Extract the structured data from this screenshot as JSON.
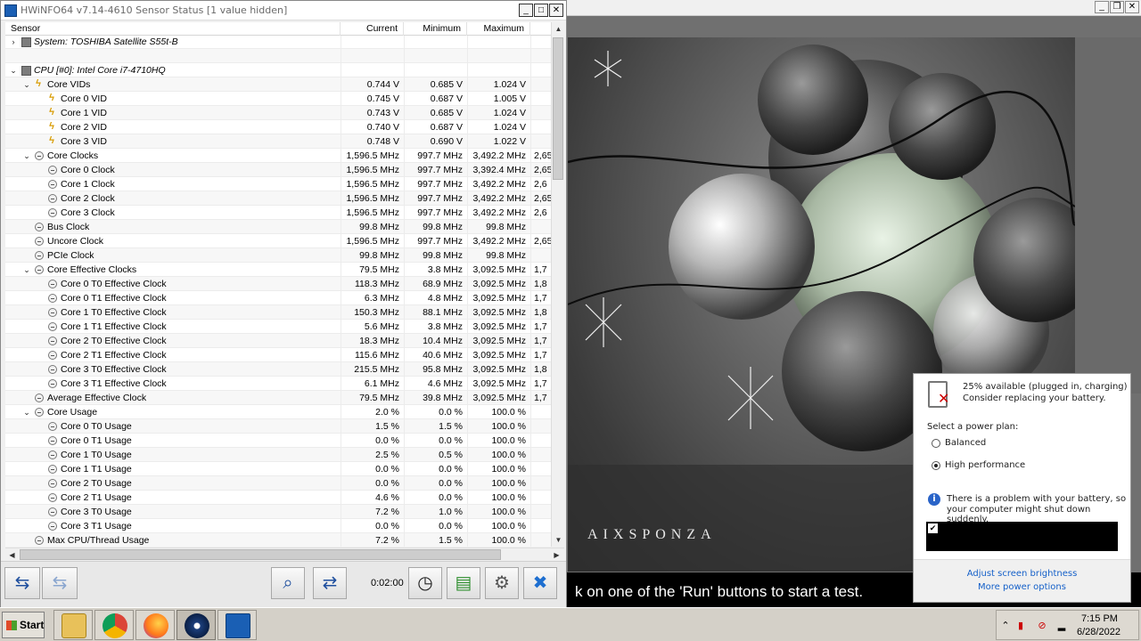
{
  "hwinfo": {
    "title": "HWiNFO64 v7.14-4610 Sensor Status [1 value hidden]",
    "columns": {
      "sensor": "Sensor",
      "current": "Current",
      "minimum": "Minimum",
      "maximum": "Maximum"
    },
    "rows": [
      {
        "label": "System: TOSHIBA Satellite S55t-B",
        "icon": "device-icon",
        "type": "device",
        "expand": "collapsed",
        "indent": 0,
        "current": "",
        "min": "",
        "max": "",
        "avg": ""
      },
      {
        "label": "",
        "icon": "",
        "type": "blank",
        "expand": "",
        "indent": 0,
        "current": "",
        "min": "",
        "max": "",
        "avg": ""
      },
      {
        "label": "CPU [#0]: Intel Core i7-4710HQ",
        "icon": "device-icon",
        "type": "device",
        "expand": "expanded",
        "indent": 0,
        "current": "",
        "min": "",
        "max": "",
        "avg": ""
      },
      {
        "label": "Core VIDs",
        "icon": "voltage-icon",
        "type": "group",
        "expand": "expanded",
        "indent": 1,
        "current": "0.744 V",
        "min": "0.685 V",
        "max": "1.024 V",
        "avg": ""
      },
      {
        "label": "Core 0 VID",
        "icon": "voltage-icon",
        "type": "item",
        "expand": "",
        "indent": 2,
        "current": "0.745 V",
        "min": "0.687 V",
        "max": "1.005 V",
        "avg": ""
      },
      {
        "label": "Core 1 VID",
        "icon": "voltage-icon",
        "type": "item",
        "expand": "",
        "indent": 2,
        "current": "0.743 V",
        "min": "0.685 V",
        "max": "1.024 V",
        "avg": ""
      },
      {
        "label": "Core 2 VID",
        "icon": "voltage-icon",
        "type": "item",
        "expand": "",
        "indent": 2,
        "current": "0.740 V",
        "min": "0.687 V",
        "max": "1.024 V",
        "avg": ""
      },
      {
        "label": "Core 3 VID",
        "icon": "voltage-icon",
        "type": "item",
        "expand": "",
        "indent": 2,
        "current": "0.748 V",
        "min": "0.690 V",
        "max": "1.022 V",
        "avg": ""
      },
      {
        "label": "Core Clocks",
        "icon": "clock-icon",
        "type": "group",
        "expand": "expanded",
        "indent": 1,
        "current": "1,596.5 MHz",
        "min": "997.7 MHz",
        "max": "3,492.2 MHz",
        "avg": "2,65"
      },
      {
        "label": "Core 0 Clock",
        "icon": "clock-icon",
        "type": "item",
        "expand": "",
        "indent": 2,
        "current": "1,596.5 MHz",
        "min": "997.7 MHz",
        "max": "3,392.4 MHz",
        "avg": "2,65"
      },
      {
        "label": "Core 1 Clock",
        "icon": "clock-icon",
        "type": "item",
        "expand": "",
        "indent": 2,
        "current": "1,596.5 MHz",
        "min": "997.7 MHz",
        "max": "3,492.2 MHz",
        "avg": "2,6"
      },
      {
        "label": "Core 2 Clock",
        "icon": "clock-icon",
        "type": "item",
        "expand": "",
        "indent": 2,
        "current": "1,596.5 MHz",
        "min": "997.7 MHz",
        "max": "3,492.2 MHz",
        "avg": "2,65"
      },
      {
        "label": "Core 3 Clock",
        "icon": "clock-icon",
        "type": "item",
        "expand": "",
        "indent": 2,
        "current": "1,596.5 MHz",
        "min": "997.7 MHz",
        "max": "3,492.2 MHz",
        "avg": "2,6"
      },
      {
        "label": "Bus Clock",
        "icon": "clock-icon",
        "type": "item",
        "expand": "",
        "indent": 1,
        "current": "99.8 MHz",
        "min": "99.8 MHz",
        "max": "99.8 MHz",
        "avg": ""
      },
      {
        "label": "Uncore Clock",
        "icon": "clock-icon",
        "type": "item",
        "expand": "",
        "indent": 1,
        "current": "1,596.5 MHz",
        "min": "997.7 MHz",
        "max": "3,492.2 MHz",
        "avg": "2,65"
      },
      {
        "label": "PCIe Clock",
        "icon": "clock-icon",
        "type": "item",
        "expand": "",
        "indent": 1,
        "current": "99.8 MHz",
        "min": "99.8 MHz",
        "max": "99.8 MHz",
        "avg": ""
      },
      {
        "label": "Core Effective Clocks",
        "icon": "clock-icon",
        "type": "group",
        "expand": "expanded",
        "indent": 1,
        "current": "79.5 MHz",
        "min": "3.8 MHz",
        "max": "3,092.5 MHz",
        "avg": "1,7"
      },
      {
        "label": "Core 0 T0 Effective Clock",
        "icon": "clock-icon",
        "type": "item",
        "expand": "",
        "indent": 2,
        "current": "118.3 MHz",
        "min": "68.9 MHz",
        "max": "3,092.5 MHz",
        "avg": "1,8"
      },
      {
        "label": "Core 0 T1 Effective Clock",
        "icon": "clock-icon",
        "type": "item",
        "expand": "",
        "indent": 2,
        "current": "6.3 MHz",
        "min": "4.8 MHz",
        "max": "3,092.5 MHz",
        "avg": "1,7"
      },
      {
        "label": "Core 1 T0 Effective Clock",
        "icon": "clock-icon",
        "type": "item",
        "expand": "",
        "indent": 2,
        "current": "150.3 MHz",
        "min": "88.1 MHz",
        "max": "3,092.5 MHz",
        "avg": "1,8"
      },
      {
        "label": "Core 1 T1 Effective Clock",
        "icon": "clock-icon",
        "type": "item",
        "expand": "",
        "indent": 2,
        "current": "5.6 MHz",
        "min": "3.8 MHz",
        "max": "3,092.5 MHz",
        "avg": "1,7"
      },
      {
        "label": "Core 2 T0 Effective Clock",
        "icon": "clock-icon",
        "type": "item",
        "expand": "",
        "indent": 2,
        "current": "18.3 MHz",
        "min": "10.4 MHz",
        "max": "3,092.5 MHz",
        "avg": "1,7"
      },
      {
        "label": "Core 2 T1 Effective Clock",
        "icon": "clock-icon",
        "type": "item",
        "expand": "",
        "indent": 2,
        "current": "115.6 MHz",
        "min": "40.6 MHz",
        "max": "3,092.5 MHz",
        "avg": "1,7"
      },
      {
        "label": "Core 3 T0 Effective Clock",
        "icon": "clock-icon",
        "type": "item",
        "expand": "",
        "indent": 2,
        "current": "215.5 MHz",
        "min": "95.8 MHz",
        "max": "3,092.5 MHz",
        "avg": "1,8"
      },
      {
        "label": "Core 3 T1 Effective Clock",
        "icon": "clock-icon",
        "type": "item",
        "expand": "",
        "indent": 2,
        "current": "6.1 MHz",
        "min": "4.6 MHz",
        "max": "3,092.5 MHz",
        "avg": "1,7"
      },
      {
        "label": "Average Effective Clock",
        "icon": "clock-icon",
        "type": "item",
        "expand": "",
        "indent": 1,
        "current": "79.5 MHz",
        "min": "39.8 MHz",
        "max": "3,092.5 MHz",
        "avg": "1,7"
      },
      {
        "label": "Core Usage",
        "icon": "clock-icon",
        "type": "group",
        "expand": "expanded",
        "indent": 1,
        "current": "2.0 %",
        "min": "0.0 %",
        "max": "100.0 %",
        "avg": ""
      },
      {
        "label": "Core 0 T0 Usage",
        "icon": "clock-icon",
        "type": "item",
        "expand": "",
        "indent": 2,
        "current": "1.5 %",
        "min": "1.5 %",
        "max": "100.0 %",
        "avg": ""
      },
      {
        "label": "Core 0 T1 Usage",
        "icon": "clock-icon",
        "type": "item",
        "expand": "",
        "indent": 2,
        "current": "0.0 %",
        "min": "0.0 %",
        "max": "100.0 %",
        "avg": ""
      },
      {
        "label": "Core 1 T0 Usage",
        "icon": "clock-icon",
        "type": "item",
        "expand": "",
        "indent": 2,
        "current": "2.5 %",
        "min": "0.5 %",
        "max": "100.0 %",
        "avg": ""
      },
      {
        "label": "Core 1 T1 Usage",
        "icon": "clock-icon",
        "type": "item",
        "expand": "",
        "indent": 2,
        "current": "0.0 %",
        "min": "0.0 %",
        "max": "100.0 %",
        "avg": ""
      },
      {
        "label": "Core 2 T0 Usage",
        "icon": "clock-icon",
        "type": "item",
        "expand": "",
        "indent": 2,
        "current": "0.0 %",
        "min": "0.0 %",
        "max": "100.0 %",
        "avg": ""
      },
      {
        "label": "Core 2 T1 Usage",
        "icon": "clock-icon",
        "type": "item",
        "expand": "",
        "indent": 2,
        "current": "4.6 %",
        "min": "0.0 %",
        "max": "100.0 %",
        "avg": ""
      },
      {
        "label": "Core 3 T0 Usage",
        "icon": "clock-icon",
        "type": "item",
        "expand": "",
        "indent": 2,
        "current": "7.2 %",
        "min": "1.0 %",
        "max": "100.0 %",
        "avg": ""
      },
      {
        "label": "Core 3 T1 Usage",
        "icon": "clock-icon",
        "type": "item",
        "expand": "",
        "indent": 2,
        "current": "0.0 %",
        "min": "0.0 %",
        "max": "100.0 %",
        "avg": ""
      },
      {
        "label": "Max CPU/Thread Usage",
        "icon": "clock-icon",
        "type": "item",
        "expand": "",
        "indent": 1,
        "current": "7.2 %",
        "min": "1.5 %",
        "max": "100.0 %",
        "avg": ""
      }
    ],
    "timer": "0:02:00"
  },
  "benchmark": {
    "status_text": "k on one of the 'Run' buttons to start a test.",
    "logo_text": "AIXSPONZA"
  },
  "power_popup": {
    "status_line1": "25% available (plugged in, charging)",
    "status_line2": "Consider replacing your battery.",
    "select_label": "Select a power plan:",
    "plans": [
      {
        "label": "Balanced",
        "selected": false
      },
      {
        "label": "High performance",
        "selected": true
      }
    ],
    "warning_line1": "There is a problem with your battery, so",
    "warning_line2": "your computer might shut down suddenly.",
    "link_brightness": "Adjust screen brightness",
    "link_more": "More power options"
  },
  "taskbar": {
    "start_label": "Start",
    "apps": [
      "file-explorer-icon",
      "chrome-icon",
      "firefox-icon",
      "cinebench-icon",
      "hwinfo-icon"
    ],
    "clock_time": "7:15 PM",
    "clock_date": "6/28/2022"
  }
}
